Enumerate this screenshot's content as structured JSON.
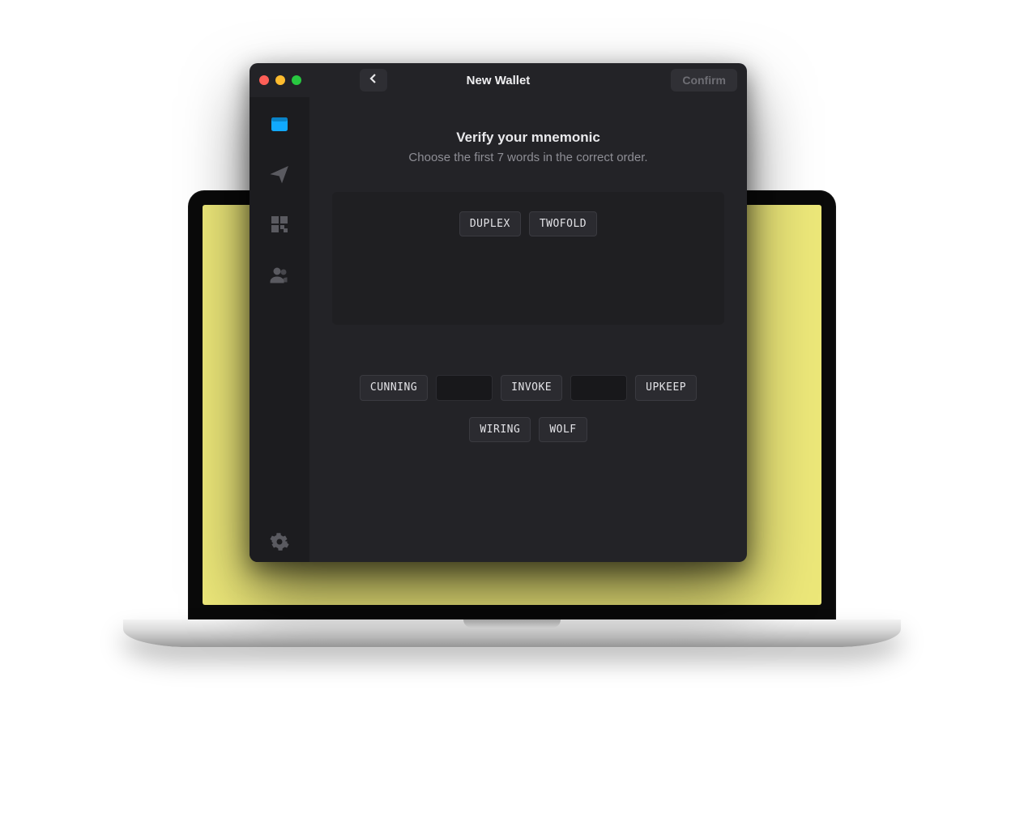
{
  "header": {
    "title": "New Wallet",
    "confirm_label": "Confirm"
  },
  "sidebar": {
    "items": [
      {
        "name": "wallet",
        "active": true
      },
      {
        "name": "send",
        "active": false
      },
      {
        "name": "qr",
        "active": false
      },
      {
        "name": "contacts",
        "active": false
      }
    ],
    "settings_name": "settings"
  },
  "content": {
    "heading": "Verify your mnemonic",
    "subheading": "Choose the first 7 words in the correct order.",
    "selected_words": [
      "DUPLEX",
      "TWOFOLD"
    ],
    "pool_rows": [
      [
        "CUNNING",
        "",
        "INVOKE",
        "",
        "UPKEEP"
      ],
      [
        "WIRING",
        "WOLF"
      ]
    ]
  }
}
